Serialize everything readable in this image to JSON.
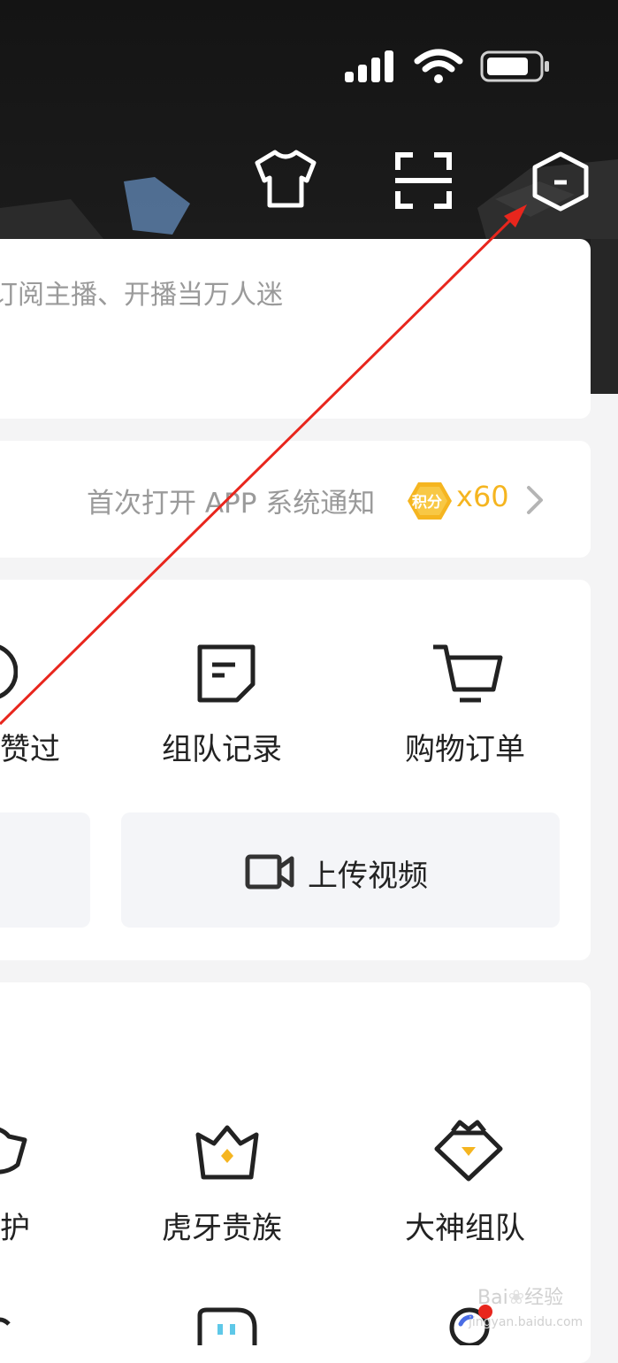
{
  "status_bar": {
    "icons": [
      "signal-icon",
      "wifi-icon",
      "battery-icon"
    ]
  },
  "header": {
    "icons": [
      "skin-icon",
      "scan-icon",
      "hexagon-settings-icon"
    ]
  },
  "profile_card": {
    "subtitle": "订阅主播、开播当万人迷"
  },
  "notice": {
    "text": "首次打开 APP 系统通知",
    "badge": "积分",
    "reward": "x60"
  },
  "quick_grid": {
    "items": [
      {
        "label": "赞过",
        "icon": "like-circle-icon"
      },
      {
        "label": "组队记录",
        "icon": "note-icon"
      },
      {
        "label": "购物订单",
        "icon": "cart-icon"
      }
    ],
    "upload_label": "上传视频"
  },
  "services": {
    "items": [
      {
        "label": "守护",
        "icon": "shield-cup-icon"
      },
      {
        "label": "虎牙贵族",
        "icon": "crown-icon"
      },
      {
        "label": "大神组队",
        "icon": "gem-crown-icon"
      }
    ]
  },
  "watermark": {
    "brand": "Bai",
    "brand_suffix": "经验",
    "url": "jingyan.baidu.com"
  },
  "colors": {
    "accent_yellow": "#f5b520",
    "arrow_red": "#e8261d",
    "header_dark": "#151515"
  }
}
